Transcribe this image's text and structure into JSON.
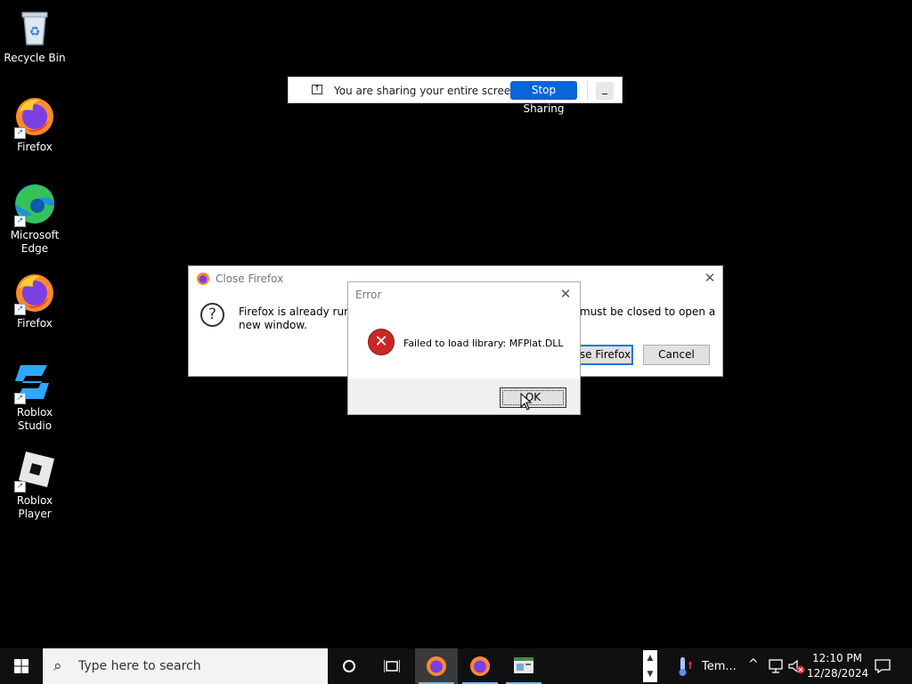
{
  "desktop": {
    "icons": [
      {
        "label": "Recycle Bin",
        "icon": "recycle-bin-icon"
      },
      {
        "label": "Firefox",
        "icon": "firefox-icon"
      },
      {
        "label": "Microsoft Edge",
        "icon": "edge-icon"
      },
      {
        "label": "Firefox",
        "icon": "firefox-icon"
      },
      {
        "label": "Roblox Studio",
        "icon": "roblox-studio-icon"
      },
      {
        "label": "Roblox Player",
        "icon": "roblox-player-icon"
      }
    ]
  },
  "share_bar": {
    "message": "You are sharing your entire screen.",
    "stop_label": "Stop Sharing",
    "minimize_glyph": "_"
  },
  "firefox_dialog": {
    "title": "Close Firefox",
    "message_left": "Firefox is already runnin",
    "message_right": "must be closed to open a",
    "message_line2": "new window.",
    "primary_button": "se Firefox",
    "cancel_button": "Cancel",
    "close_glyph": "✕",
    "question_glyph": "?"
  },
  "error_dialog": {
    "title": "Error",
    "message": "Failed to load library: MFPlat.DLL",
    "ok_button": "OK",
    "close_glyph": "✕",
    "error_glyph": "✕"
  },
  "taskbar": {
    "search_placeholder": "Type here to search",
    "weather_text": "Tem...",
    "time": "12:10 PM",
    "date": "12/28/2024"
  },
  "colors": {
    "accent": "#0078d7",
    "stop_sharing": "#0a66d8",
    "taskbar": "#101010",
    "error_red": "#c62828"
  }
}
